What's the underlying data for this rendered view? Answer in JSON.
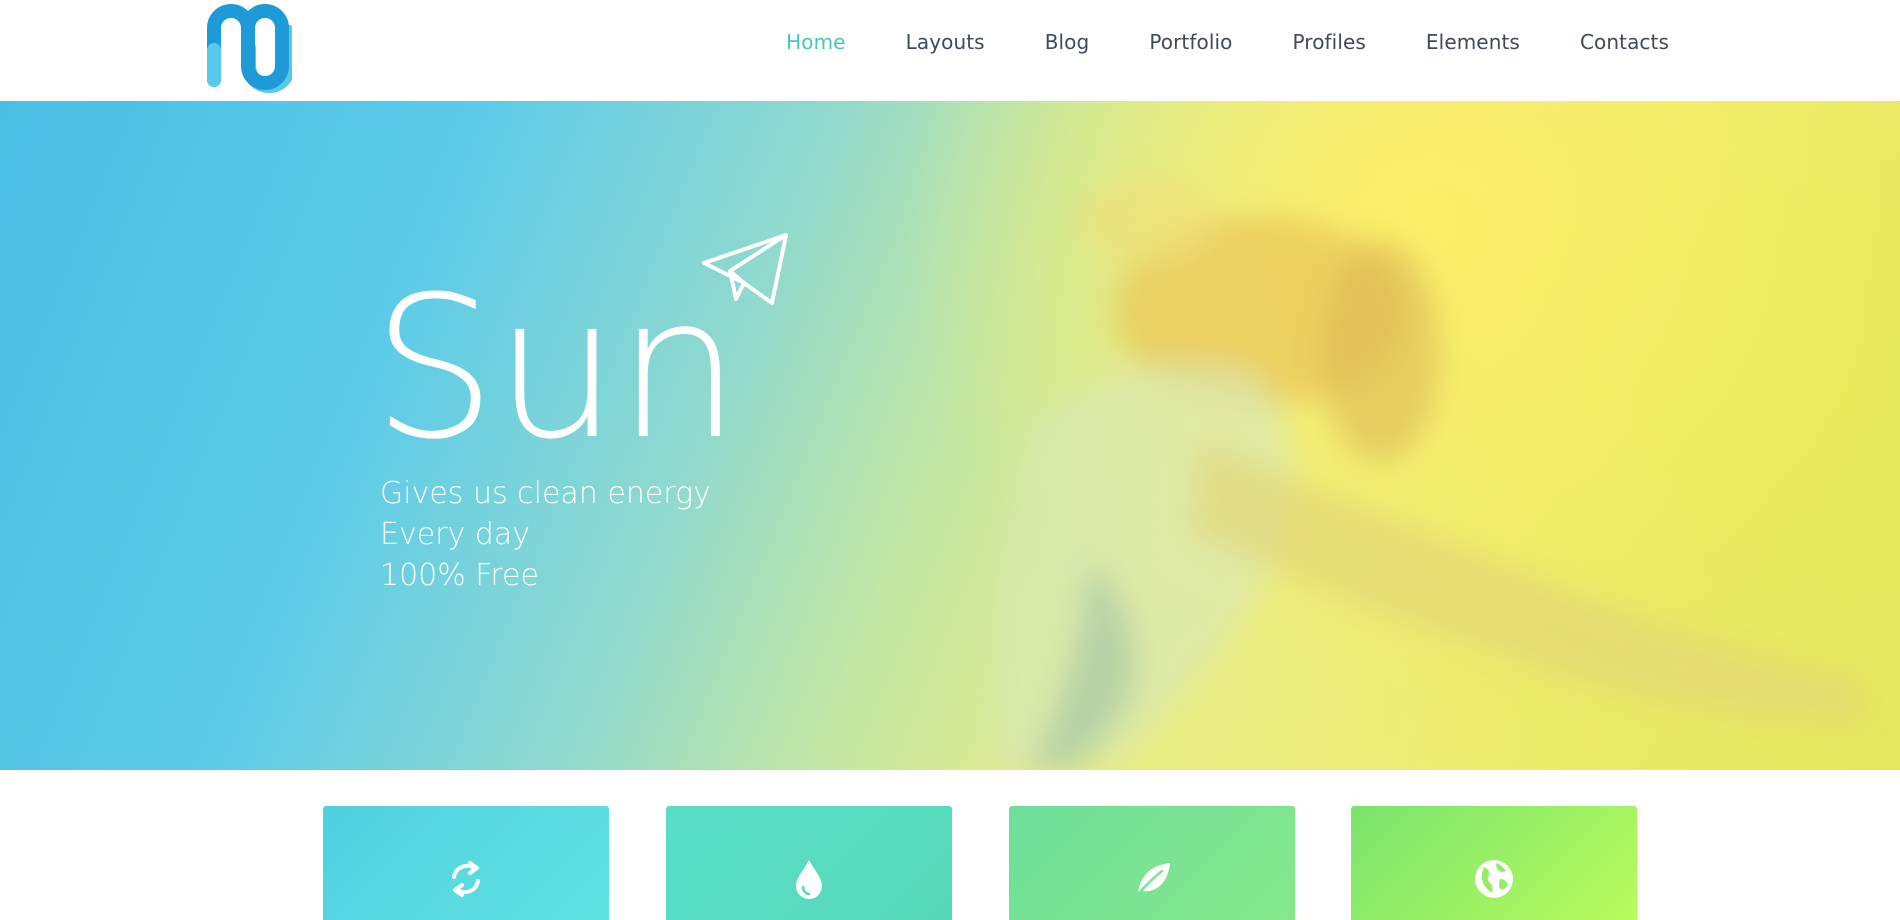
{
  "header": {
    "logo_icon": "m-logo-icon",
    "nav": [
      {
        "label": "Home",
        "active": true
      },
      {
        "label": "Layouts",
        "active": false
      },
      {
        "label": "Blog",
        "active": false
      },
      {
        "label": "Portfolio",
        "active": false
      },
      {
        "label": "Profiles",
        "active": false
      },
      {
        "label": "Elements",
        "active": false
      },
      {
        "label": "Contacts",
        "active": false
      }
    ]
  },
  "hero": {
    "title": "Sun",
    "lines": [
      "Gives us clean energy",
      "Every day",
      "100% Free"
    ],
    "decoration_icon": "paper-plane-icon"
  },
  "features": [
    {
      "icon": "refresh-icon"
    },
    {
      "icon": "water-drop-icon"
    },
    {
      "icon": "leaf-icon"
    },
    {
      "icon": "globe-icon"
    }
  ],
  "colors": {
    "accent": "#46c9b4",
    "nav_text": "#3f4a5a",
    "logo_blue": "#1e9ad9",
    "logo_light": "#57c9ea"
  }
}
